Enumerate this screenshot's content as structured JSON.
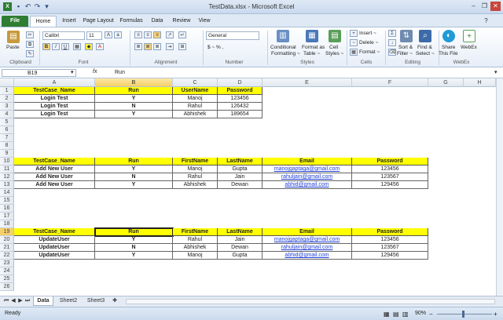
{
  "window": {
    "title": "TestData.xlsx  -  Microsoft Excel"
  },
  "tabs": [
    "File",
    "Home",
    "Insert",
    "Page Layout",
    "Formulas",
    "Data",
    "Review",
    "View"
  ],
  "ribbon": {
    "clipboard": {
      "paste": "Paste",
      "label": "Clipboard"
    },
    "font": {
      "name": "Calibri",
      "size": "11",
      "label": "Font"
    },
    "alignment": {
      "label": "Alignment"
    },
    "number": {
      "format": "General",
      "currency": "$ ~ % ,",
      "label": "Number"
    },
    "styles": {
      "conditional": "Conditional",
      "conditional2": "Formatting ~",
      "format_table": "Format as",
      "format_table2": "Table ~",
      "cell_styles": "Cell",
      "cell_styles2": "Styles ~",
      "label": "Styles"
    },
    "cells": {
      "insert": "Insert ~",
      "delete": "Delete ~",
      "format": "Format ~",
      "label": "Cells"
    },
    "editing": {
      "sort": "Sort &",
      "sort2": "Filter ~",
      "find": "Find &",
      "find2": "Select ~",
      "label": "Editing"
    },
    "webex": {
      "share": "Share",
      "share2": "This File",
      "webex": "WebEx",
      "label": "WebEx"
    }
  },
  "formula_bar": {
    "name_box": "B19",
    "fx": "fx",
    "value": "Run"
  },
  "columns": [
    "A",
    "B",
    "C",
    "D",
    "E",
    "F",
    "G",
    "H"
  ],
  "rows": [
    "1",
    "2",
    "3",
    "4",
    "5",
    "6",
    "7",
    "8",
    "9",
    "10",
    "11",
    "12",
    "13",
    "14",
    "15",
    "16",
    "17",
    "18",
    "19",
    "20",
    "21",
    "22",
    "23",
    "24",
    "25",
    "26"
  ],
  "table1": {
    "headers": [
      "TestCase_Name",
      "Run",
      "UserName",
      "Password"
    ],
    "rows": [
      [
        "Login Test",
        "Y",
        "Manoj",
        "123456"
      ],
      [
        "Login Test",
        "N",
        "Rahul",
        "126432"
      ],
      [
        "Login Test",
        "Y",
        "Abhishek",
        "189654"
      ]
    ]
  },
  "table2": {
    "headers": [
      "TestCase_Name",
      "Run",
      "FirstName",
      "LastName",
      "Email",
      "Password"
    ],
    "rows": [
      [
        "Add New User",
        "Y",
        "Manoj",
        "Gupta",
        "manojgaptaga@gmail.com",
        "123456"
      ],
      [
        "Add New User",
        "N",
        "Rahul",
        "Jain",
        "rahuljain@gmail.com",
        "123567"
      ],
      [
        "Add New User",
        "Y",
        "Abhishek",
        "Dewan",
        "abhid@gmail.com",
        "129456"
      ]
    ]
  },
  "table3": {
    "headers": [
      "TestCase_Name",
      "Run",
      "FirstName",
      "LastName",
      "Email",
      "Password"
    ],
    "rows": [
      [
        "UpdateUser",
        "Y",
        "Rahul",
        "Jain",
        "manojgaptaga@gmail.com",
        "123456"
      ],
      [
        "UpdateUser",
        "N",
        "Abhishek",
        "Dewan",
        "rahuljain@gmail.com",
        "123567"
      ],
      [
        "UpdateUser",
        "Y",
        "Manoj",
        "Gupta",
        "abhid@gmail.com",
        "129456"
      ]
    ]
  },
  "sheets": [
    "Data",
    "Sheet2",
    "Sheet3"
  ],
  "status": {
    "text": "Ready",
    "zoom": "90%"
  }
}
